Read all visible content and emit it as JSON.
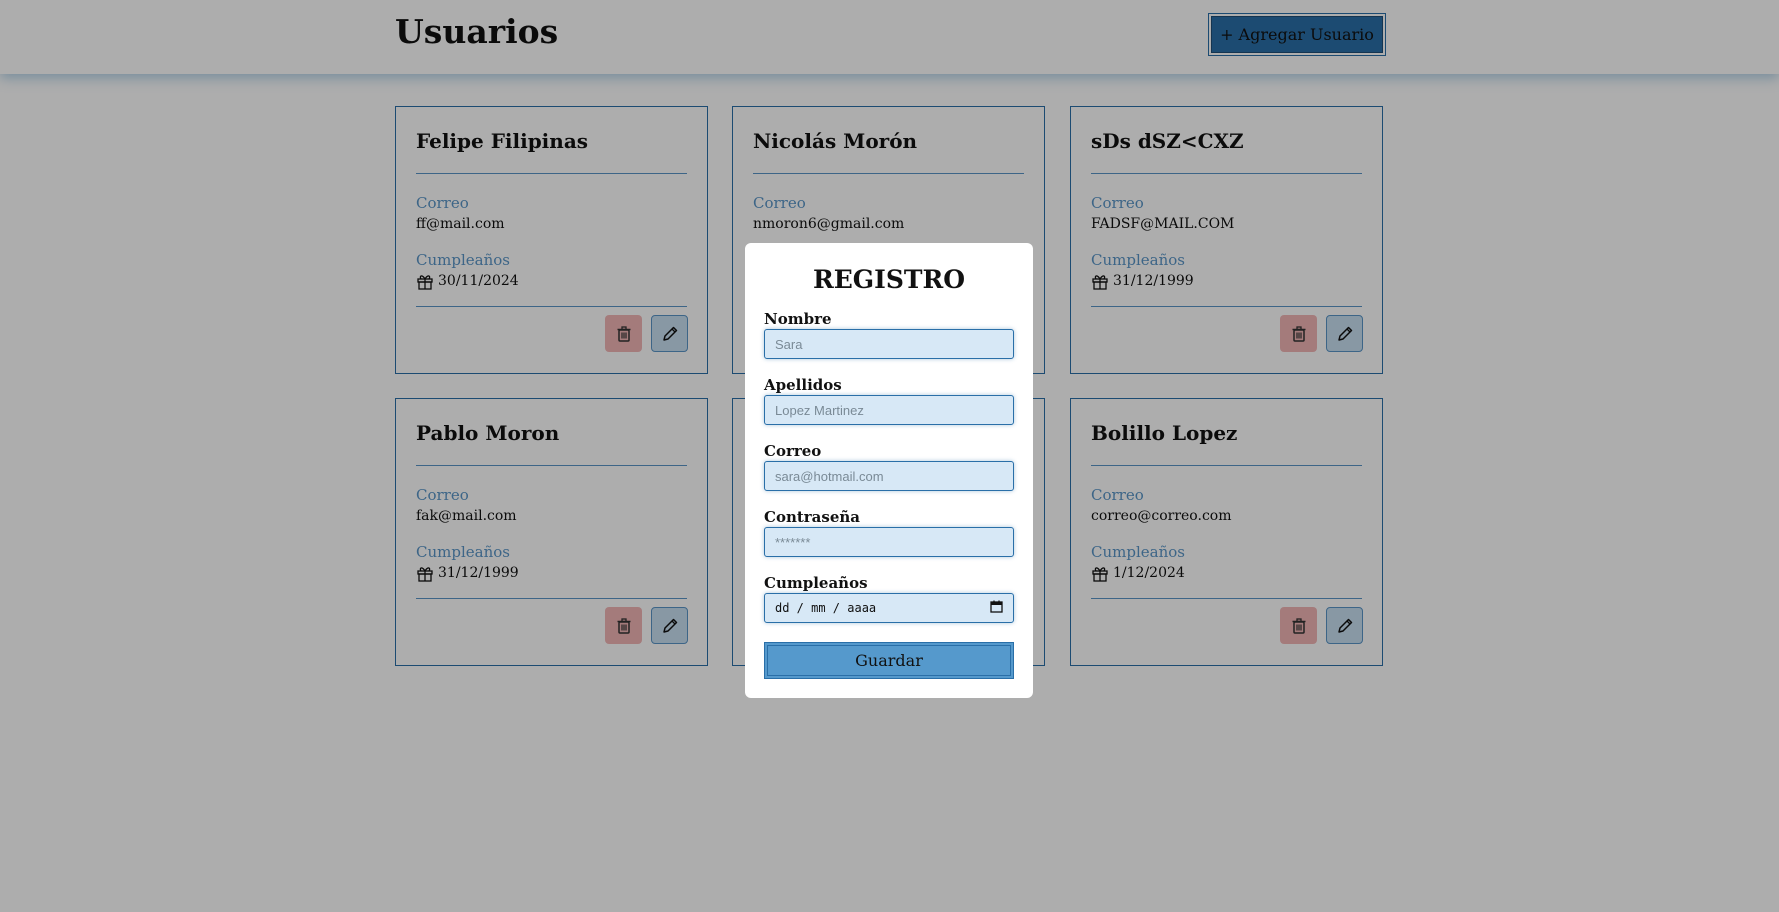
{
  "header": {
    "title": "Usuarios",
    "add_button": "+ Agregar Usuario"
  },
  "cards": [
    {
      "name": "Felipe Filipinas",
      "email_label": "Correo",
      "email": "ff@mail.com",
      "birthday_label": "Cumpleaños",
      "birthday": "30/11/2024",
      "show_birthday": true
    },
    {
      "name": "Nicolás Morón",
      "email_label": "Correo",
      "email": "nmoron6@gmail.com",
      "birthday_label": "",
      "birthday": "",
      "show_birthday": false
    },
    {
      "name": "sDs dSZ<CXZ",
      "email_label": "Correo",
      "email": "FADSF@MAIL.COM",
      "birthday_label": "Cumpleaños",
      "birthday": "31/12/1999",
      "show_birthday": true
    },
    {
      "name": "Pablo Moron",
      "email_label": "Correo",
      "email": "fak@mail.com",
      "birthday_label": "Cumpleaños",
      "birthday": "31/12/1999",
      "show_birthday": true
    },
    {
      "name": "",
      "email_label": "",
      "email": "",
      "birthday_label": "",
      "birthday": "",
      "show_birthday": false
    },
    {
      "name": "Bolillo Lopez",
      "email_label": "Correo",
      "email": "correo@correo.com",
      "birthday_label": "Cumpleaños",
      "birthday": "1/12/2024",
      "show_birthday": true
    }
  ],
  "modal": {
    "title": "REGISTRO",
    "fields": {
      "nombre": {
        "label": "Nombre",
        "placeholder": "Sara"
      },
      "apellidos": {
        "label": "Apellidos",
        "placeholder": "Lopez Martinez"
      },
      "correo": {
        "label": "Correo",
        "placeholder": "sara@hotmail.com"
      },
      "contrasena": {
        "label": "Contraseña",
        "placeholder": "*******"
      },
      "cumpleanos": {
        "label": "Cumpleaños",
        "placeholder": "dd / mm / aaaa"
      }
    },
    "save_button": "Guardar"
  },
  "icons": {
    "delete": "trash-icon",
    "edit": "pencil-icon",
    "birthday": "gift-icon",
    "calendar": "calendar-icon"
  },
  "colors": {
    "accent": "#2a6fa8",
    "label": "#5a96c8",
    "delete_bg": "#f2b6b6",
    "edit_bg": "#c9e0f2",
    "save_bg": "#5599cc"
  }
}
